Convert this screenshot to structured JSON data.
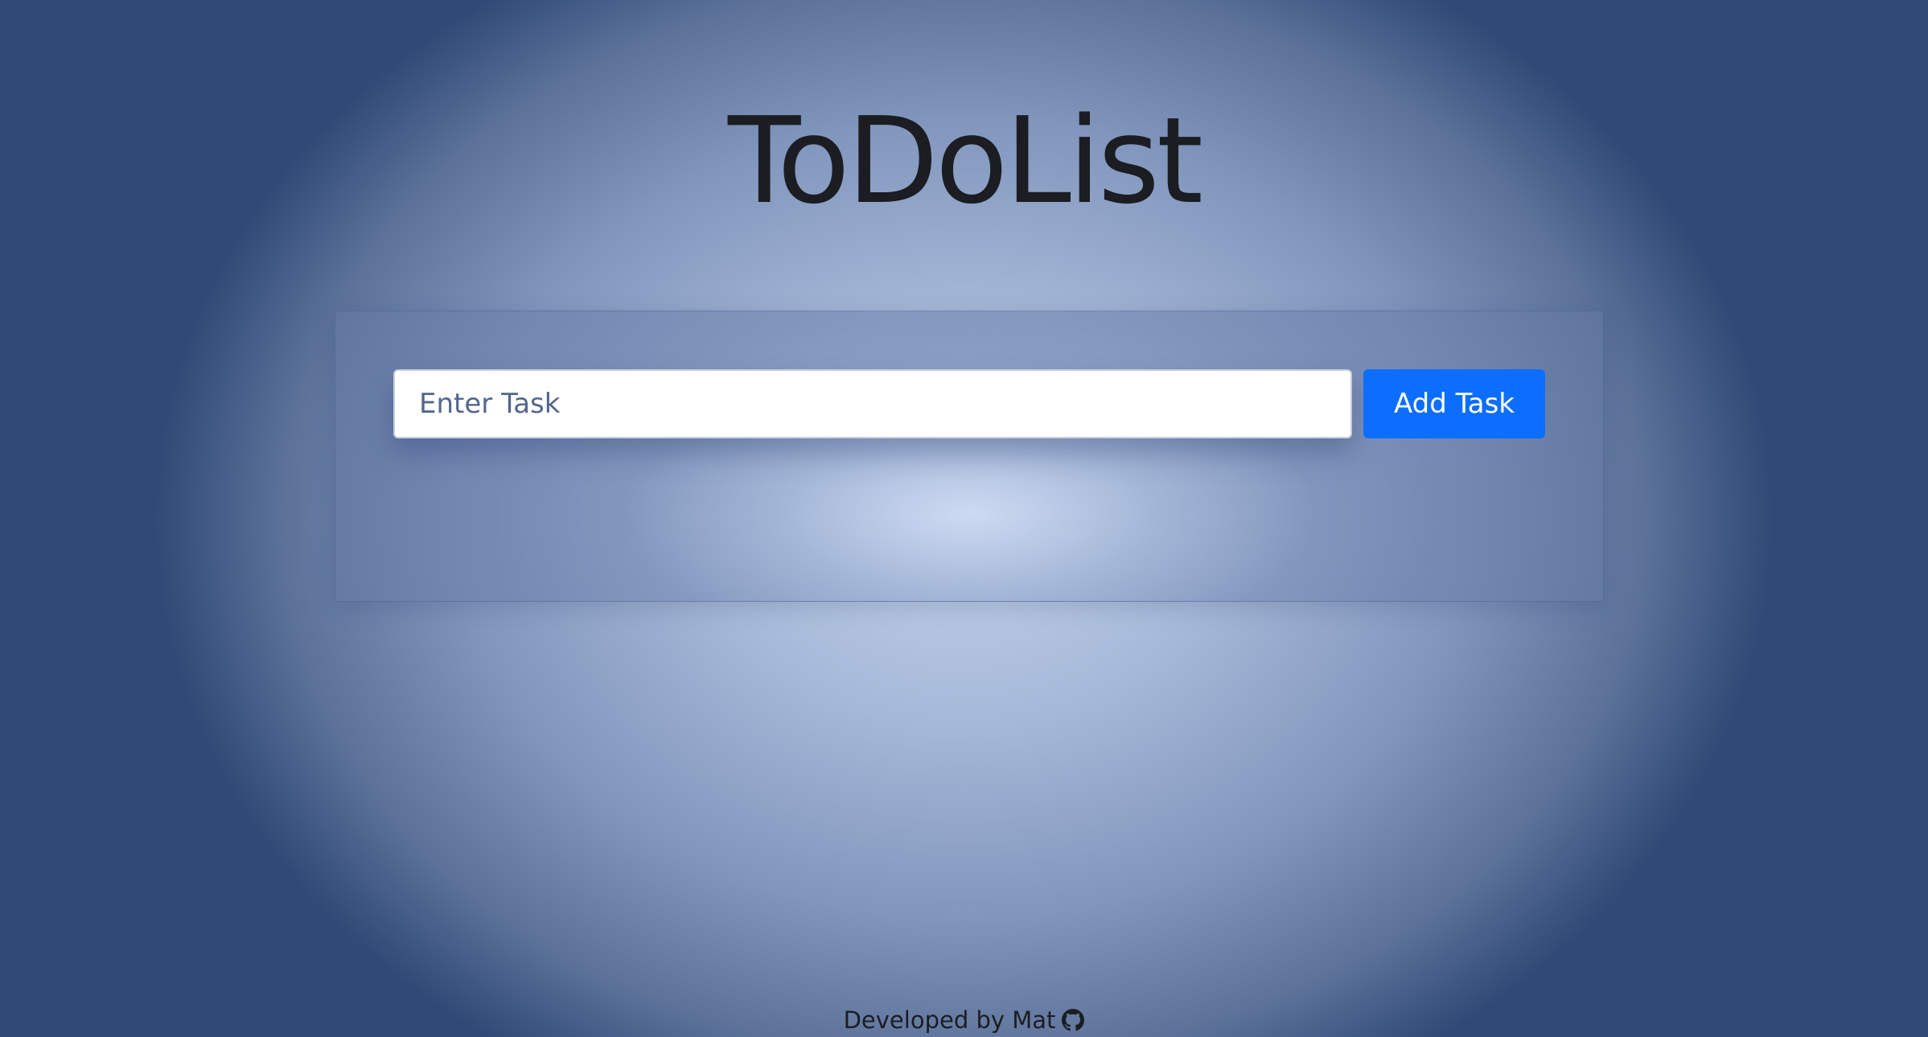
{
  "app": {
    "title": "ToDoList"
  },
  "form": {
    "input_value": "",
    "input_placeholder": "Enter Task",
    "add_button_label": "Add Task"
  },
  "tasks": [],
  "footer": {
    "credit_text": "Developed by Mat",
    "icon": "github-icon"
  },
  "colors": {
    "accent": "#0d6efd",
    "background_edge": "#2f4a76",
    "background_center": "#c2d2ec"
  }
}
